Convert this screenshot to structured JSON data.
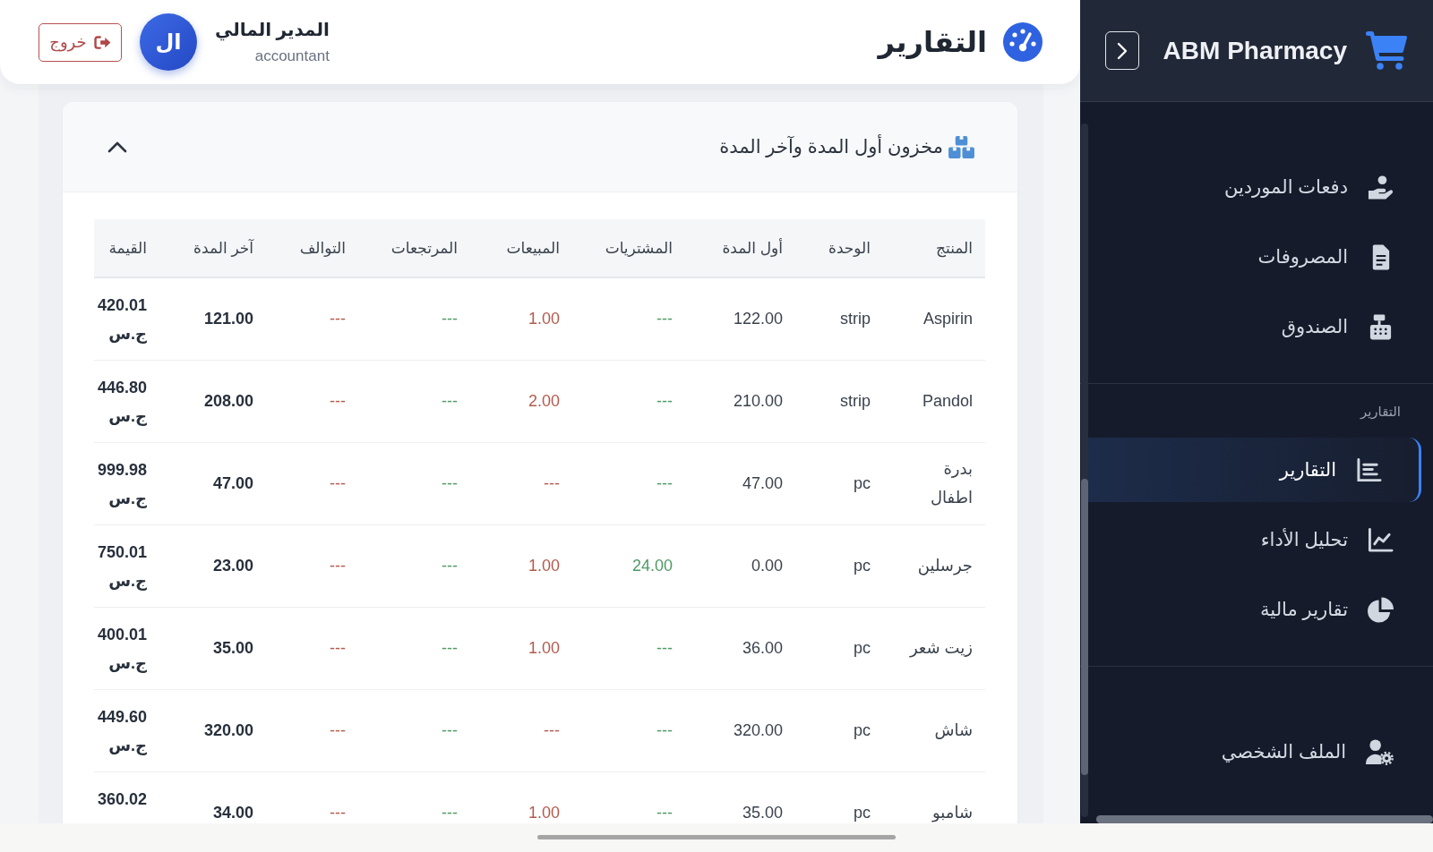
{
  "sidebar": {
    "brand": "ABM Pharmacy",
    "sections": [
      {
        "items": [
          {
            "label": "دفعات الموردين",
            "selected": false
          },
          {
            "label": "المصروفات",
            "selected": false
          },
          {
            "label": "الصندوق",
            "selected": false
          }
        ]
      },
      {
        "title": "التقارير",
        "items": [
          {
            "label": "التقارير",
            "selected": true
          },
          {
            "label": "تحليل الأداء",
            "selected": false
          },
          {
            "label": "تقارير مالية",
            "selected": false
          }
        ]
      },
      {
        "items": [
          {
            "label": "الملف الشخصي",
            "selected": false
          }
        ]
      }
    ]
  },
  "top_bar": {
    "title": "التقارير",
    "user": {
      "name": "المدير المالي",
      "role": "accountant",
      "avatar_text": "ال"
    },
    "logout": "خروج"
  },
  "card": {
    "title": "مخزون أول المدة وآخر المدة",
    "expanded": true,
    "table": {
      "columns": [
        {
          "label": "المنتج",
          "kind": "text"
        },
        {
          "label": "الوحدة",
          "kind": "text"
        },
        {
          "label": "أول المدة",
          "kind": "text"
        },
        {
          "label": "المشتريات",
          "kind": "in"
        },
        {
          "label": "المبيعات",
          "kind": "out"
        },
        {
          "label": "المرتجعات",
          "kind": "in"
        },
        {
          "label": "التوالف",
          "kind": "out"
        },
        {
          "label": "آخر المدة",
          "kind": "total"
        },
        {
          "label": "القيمة",
          "kind": "total"
        }
      ],
      "rows": [
        [
          "Aspirin",
          "strip",
          "122.00",
          "---",
          "1.00",
          "---",
          "---",
          "121.00",
          "420.01 ج.س"
        ],
        [
          "Pandol",
          "strip",
          "210.00",
          "---",
          "2.00",
          "---",
          "---",
          "208.00",
          "446.80 ج.س"
        ],
        [
          "بدرة اطفال",
          "pc",
          "47.00",
          "---",
          "---",
          "---",
          "---",
          "47.00",
          "999.98 ج.س"
        ],
        [
          "جرسلين",
          "pc",
          "0.00",
          "24.00",
          "1.00",
          "---",
          "---",
          "23.00",
          "750.01 ج.س"
        ],
        [
          "زيت شعر",
          "pc",
          "36.00",
          "---",
          "1.00",
          "---",
          "---",
          "35.00",
          "400.01 ج.س"
        ],
        [
          "شاش",
          "pc",
          "320.00",
          "---",
          "---",
          "---",
          "---",
          "320.00",
          "449.60 ج.س"
        ],
        [
          "شامبو",
          "pc",
          "35.00",
          "---",
          "1.00",
          "---",
          "---",
          "34.00",
          "360.02"
        ]
      ]
    }
  }
}
